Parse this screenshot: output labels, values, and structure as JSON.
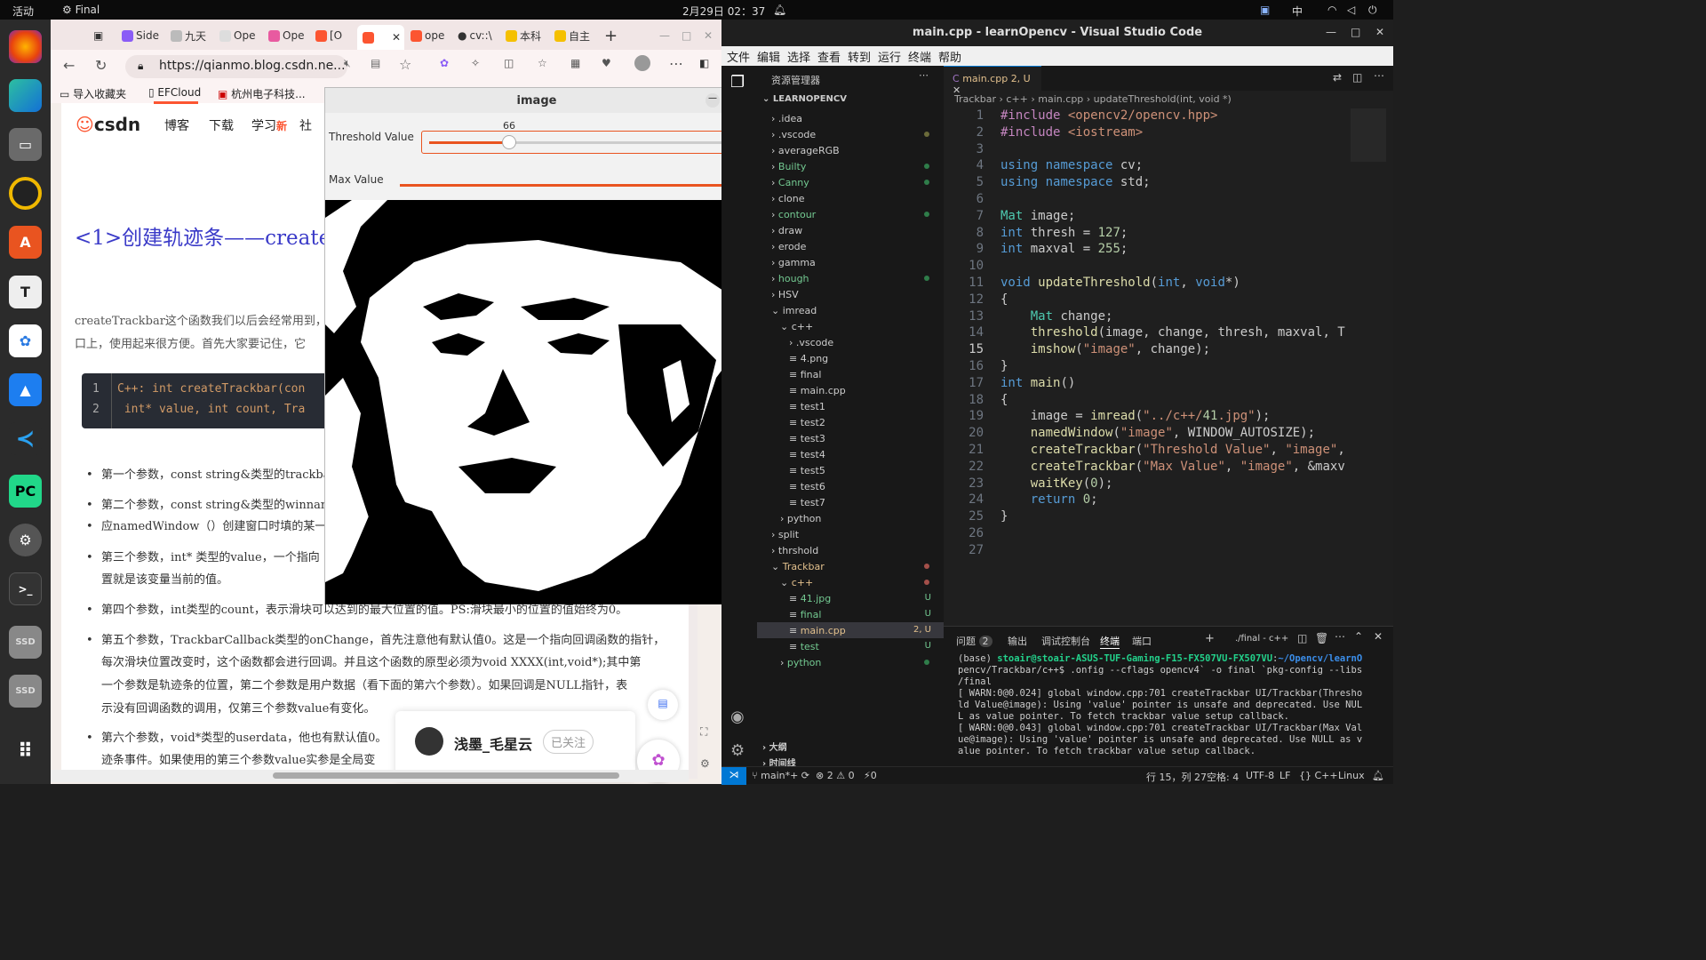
{
  "topbar": {
    "activities": "活动",
    "app": "Final",
    "clock": "2月29日 02：37",
    "input_method": "中"
  },
  "browser": {
    "tabs": [
      "Side",
      "九天",
      "Ope",
      "Ope",
      "[O",
      "",
      "ope",
      "cv::\\",
      "本科",
      "自主"
    ],
    "url": "https://qianmo.blog.csdn.ne...",
    "bookmarks": [
      "导入收藏夹",
      "EFCloud",
      "杭州电子科技..."
    ],
    "nav": [
      "博客",
      "下载",
      "学习",
      "社"
    ],
    "nav_new": "新",
    "heading": "<1>创建轨迹条——createT",
    "intro1": "createTrackbar这个函数我们以后会经常用到，",
    "intro2": "口上，使用起来很方便。首先大家要记住，它",
    "code_l1": "C++: int createTrackbar(con",
    "code_l2": " int* value, int count, Tra",
    "bullets": [
      "第一个参数，const string&类型的trackba",
      "第二个参数，const string&类型的winnam",
      "应namedWindow（）创建窗口时填的某一",
      "第三个参数，int* 类型的value，一个指向",
      "置就是该变量当前的值。",
      "第四个参数，int类型的count，表示滑块可以达到的最大位置的值。PS:滑块最小的位置的值始终为0。",
      "第五个参数，TrackbarCallback类型的onChange，首先注意他有默认值0。这是一个指向回调函数的指针，",
      "每次滑块位置改变时，这个函数都会进行回调。并且这个函数的原型必须为void XXXX(int,void*);其中第",
      "一个参数是轨迹条的位置，第二个参数是用户数据（看下面的第六个参数）。如果回调是NULL指针，表",
      "示没有回调函数的调用，仅第三个参数value有变化。",
      "第六个参数，void*类型的userdata，他也有默认值0。",
      "迹条事件。如果使用的第三个参数value实参是全局变"
    ],
    "author": "浅墨_毛星云",
    "followed": "已关注"
  },
  "imagewin": {
    "title": "image",
    "t1_label": "Threshold Value",
    "t1_value": "66",
    "t1_frac": 0.259,
    "t2_label": "Max Value",
    "t2_value": "255",
    "t2_frac": 1.0
  },
  "vscode": {
    "title": "main.cpp - learnOpencv - Visual Studio Code",
    "menu": [
      "文件",
      "编辑",
      "选择",
      "查看",
      "转到",
      "运行",
      "终端",
      "帮助"
    ],
    "explorer_title": "资源管理器",
    "root": "LEARNOPENCV",
    "tree": [
      {
        "t": ".idea",
        "d": 0,
        "c": "#cccccc"
      },
      {
        "t": ".vscode",
        "d": 0,
        "c": "#cccccc",
        "dot": "#6b6b3a"
      },
      {
        "t": "averageRGB",
        "d": 0,
        "c": "#cccccc"
      },
      {
        "t": "Builty",
        "d": 0,
        "c": "#73c991",
        "dot": "#2f7d4a"
      },
      {
        "t": "Canny",
        "d": 0,
        "c": "#73c991",
        "dot": "#2f7d4a"
      },
      {
        "t": "clone",
        "d": 0,
        "c": "#cccccc"
      },
      {
        "t": "contour",
        "d": 0,
        "c": "#73c991",
        "dot": "#2f7d4a"
      },
      {
        "t": "draw",
        "d": 0,
        "c": "#cccccc"
      },
      {
        "t": "erode",
        "d": 0,
        "c": "#cccccc"
      },
      {
        "t": "gamma",
        "d": 0,
        "c": "#cccccc"
      },
      {
        "t": "hough",
        "d": 0,
        "c": "#73c991",
        "dot": "#2f7d4a"
      },
      {
        "t": "HSV",
        "d": 0,
        "c": "#cccccc"
      },
      {
        "t": "imread",
        "d": 0,
        "c": "#cccccc",
        "open": true
      },
      {
        "t": "c++",
        "d": 1,
        "c": "#cccccc",
        "open": true
      },
      {
        "t": ".vscode",
        "d": 2,
        "c": "#cccccc"
      },
      {
        "t": "4.png",
        "d": 2,
        "c": "#cccccc",
        "file": true
      },
      {
        "t": "final",
        "d": 2,
        "c": "#cccccc",
        "file": true
      },
      {
        "t": "main.cpp",
        "d": 2,
        "c": "#cccccc",
        "file": true
      },
      {
        "t": "test1",
        "d": 2,
        "c": "#cccccc",
        "file": true
      },
      {
        "t": "test2",
        "d": 2,
        "c": "#cccccc",
        "file": true
      },
      {
        "t": "test3",
        "d": 2,
        "c": "#cccccc",
        "file": true
      },
      {
        "t": "test4",
        "d": 2,
        "c": "#cccccc",
        "file": true
      },
      {
        "t": "test5",
        "d": 2,
        "c": "#cccccc",
        "file": true
      },
      {
        "t": "test6",
        "d": 2,
        "c": "#cccccc",
        "file": true
      },
      {
        "t": "test7",
        "d": 2,
        "c": "#cccccc",
        "file": true
      },
      {
        "t": "python",
        "d": 1,
        "c": "#cccccc"
      },
      {
        "t": "split",
        "d": 0,
        "c": "#cccccc"
      },
      {
        "t": "thrshold",
        "d": 0,
        "c": "#cccccc"
      },
      {
        "t": "Trackbar",
        "d": 0,
        "c": "#e2c08d",
        "dot": "#a4504a",
        "open": true
      },
      {
        "t": "c++",
        "d": 1,
        "c": "#e2c08d",
        "dot": "#a4504a",
        "open": true
      },
      {
        "t": "41.jpg",
        "d": 2,
        "c": "#73c991",
        "badge": "U",
        "file": true
      },
      {
        "t": "final",
        "d": 2,
        "c": "#73c991",
        "badge": "U",
        "file": true
      },
      {
        "t": "main.cpp",
        "d": 2,
        "c": "#e2c08d",
        "badge": "2, U",
        "sel": true,
        "file": true
      },
      {
        "t": "test",
        "d": 2,
        "c": "#73c991",
        "badge": "U",
        "file": true
      },
      {
        "t": "python",
        "d": 1,
        "c": "#73c991",
        "dot": "#2f7d4a"
      }
    ],
    "outline": "大纲",
    "timeline": "时间线",
    "tab_label": "main.cpp",
    "tab_badge": "2, U",
    "breadcrumb": "Trackbar › c++ › main.cpp › updateThreshold(int, void *)",
    "code": [
      "#include <opencv2/opencv.hpp>",
      "#include <iostream>",
      "",
      "using namespace cv;",
      "using namespace std;",
      "",
      "Mat image;",
      "int thresh = 127;",
      "int maxval = 255;",
      "",
      "void updateThreshold(int, void*)",
      "{",
      "    Mat change;",
      "    threshold(image, change, thresh, maxval, T",
      "    imshow(\"image\", change);",
      "}",
      "int main()",
      "{",
      "    image = imread(\"../c++/41.jpg\");",
      "    namedWindow(\"image\", WINDOW_AUTOSIZE);",
      "    createTrackbar(\"Threshold Value\", \"image\",",
      "    createTrackbar(\"Max Value\", \"image\", &maxv",
      "    waitKey(0);",
      "    return 0;",
      "}",
      "",
      ""
    ],
    "panel_tabs": [
      "问题",
      "输出",
      "调试控制台",
      "终端",
      "端口"
    ],
    "problems_count": "2",
    "terminal_name": "./final - c++",
    "terminal": [
      "(base) stoair@stoair-ASUS-TUF-Gaming-F15-FX507VU-FX507VU:~/Opencv/learnO",
      "pencv/Trackbar/c++$ .onfig --cflags opencv4` -o final `pkg-config --libs",
      "/final",
      "[ WARN:0@0.024] global window.cpp:701 createTrackbar UI/Trackbar(Thresho",
      "ld Value@image): Using 'value' pointer is unsafe and deprecated. Use NUL",
      "L as value pointer. To fetch trackbar value setup callback.",
      "[ WARN:0@0.043] global window.cpp:701 createTrackbar UI/Trackbar(Max Val",
      "ue@image): Using 'value' pointer is unsafe and deprecated. Use NULL as v",
      "alue pointer. To fetch trackbar value setup callback."
    ],
    "status": {
      "branch": "main*+",
      "errors": "⊗ 2 ⚠ 0",
      "ports": "⚡0",
      "pos": "行 15，列 27",
      "spaces": "空格: 4",
      "enc": "UTF-8",
      "eol": "LF",
      "lang": "{} C++",
      "os": "Linux"
    }
  },
  "colors": {
    "accent": "#007acc",
    "csdn_red": "#fc5531",
    "slider_red": "#e95420",
    "keyword": "#569cd6",
    "string": "#ce9178",
    "func": "#dcdcaa",
    "type": "#4ec9b0",
    "var": "#9cdcfe",
    "num": "#b5cea8"
  }
}
